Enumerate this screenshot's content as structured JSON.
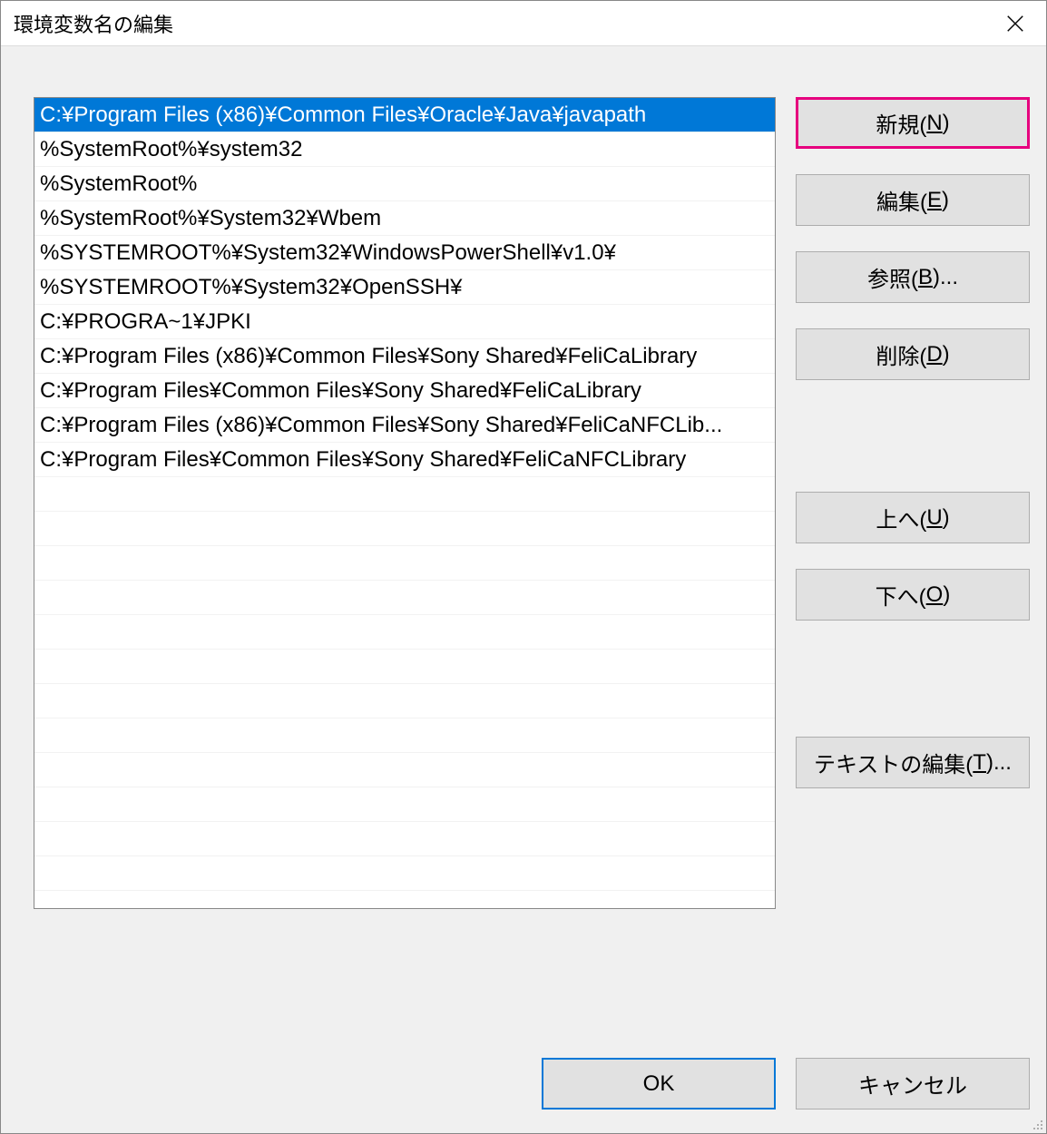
{
  "dialog": {
    "title": "環境変数名の編集"
  },
  "paths": [
    "C:¥Program Files (x86)¥Common Files¥Oracle¥Java¥javapath",
    "%SystemRoot%¥system32",
    "%SystemRoot%",
    "%SystemRoot%¥System32¥Wbem",
    "%SYSTEMROOT%¥System32¥WindowsPowerShell¥v1.0¥",
    "%SYSTEMROOT%¥System32¥OpenSSH¥",
    "C:¥PROGRA~1¥JPKI",
    "C:¥Program Files (x86)¥Common Files¥Sony Shared¥FeliCaLibrary",
    "C:¥Program Files¥Common Files¥Sony Shared¥FeliCaLibrary",
    "C:¥Program Files (x86)¥Common Files¥Sony Shared¥FeliCaNFCLib...",
    "C:¥Program Files¥Common Files¥Sony Shared¥FeliCaNFCLibrary"
  ],
  "buttons": {
    "new": {
      "text": "新規(",
      "key": "N",
      "suffix": ")"
    },
    "edit": {
      "text": "編集(",
      "key": "E",
      "suffix": ")"
    },
    "browse": {
      "text": "参照(",
      "key": "B",
      "suffix": ")..."
    },
    "delete": {
      "text": "削除(",
      "key": "D",
      "suffix": ")"
    },
    "up": {
      "text": "上へ(",
      "key": "U",
      "suffix": ")"
    },
    "down": {
      "text": "下へ(",
      "key": "O",
      "suffix": ")"
    },
    "edit_text": {
      "text": "テキストの編集(",
      "key": "T",
      "suffix": ")..."
    },
    "ok": "OK",
    "cancel": "キャンセル"
  },
  "selected_index": 0
}
